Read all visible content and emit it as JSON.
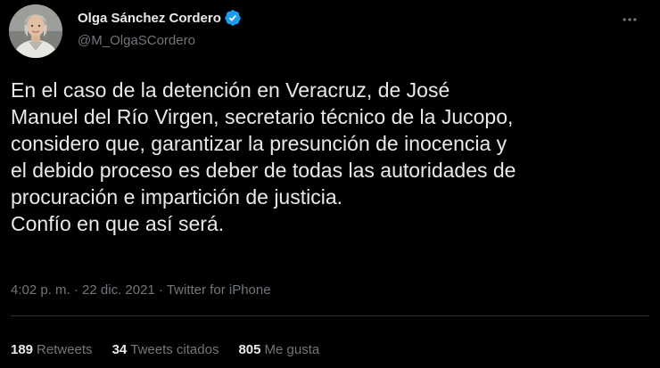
{
  "author": {
    "display_name": "Olga Sánchez Cordero",
    "handle": "@M_OlgaSCordero",
    "verified": true
  },
  "tweet": {
    "lines": [
      "En el caso de la detención en Veracruz, de José",
      "Manuel del Río Virgen, secretario técnico de la Jucopo,",
      "considero que, garantizar la presunción de inocencia y",
      "el debido proceso es deber de todas las autoridades de",
      "procuración e impartición de justicia.",
      "Confío en que así será."
    ]
  },
  "meta": {
    "time": "4:02 p. m.",
    "separator": " · ",
    "date": "22 dic. 2021",
    "source": "Twitter for iPhone"
  },
  "stats": {
    "retweets": {
      "count": "189",
      "label": "Retweets"
    },
    "quotes": {
      "count": "34",
      "label": "Tweets citados"
    },
    "likes": {
      "count": "805",
      "label": "Me gusta"
    }
  },
  "icons": {
    "verified": "verified-badge-icon",
    "more": "more-horizontal-icon"
  },
  "colors": {
    "background": "#000000",
    "primary_text": "#e7e9ea",
    "secondary_text": "#71767b",
    "divider": "#2f3336",
    "verified_badge": "#1d9bf0"
  }
}
